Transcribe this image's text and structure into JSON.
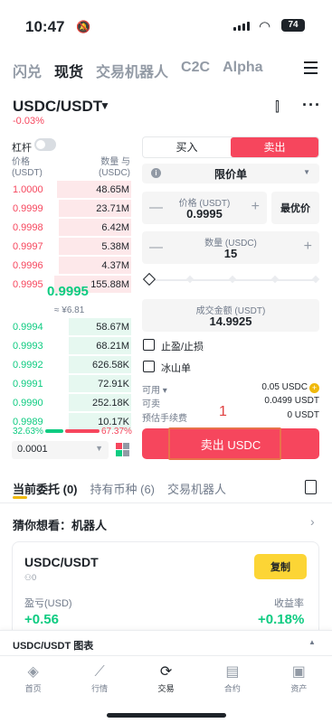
{
  "status_bar": {
    "time": "10:47",
    "battery": "74"
  },
  "top_nav": [
    "闪兑",
    "现货",
    "交易机器人",
    "C2C",
    "Alpha"
  ],
  "pair": {
    "name": "USDC/USDT",
    "change": "-0.03%"
  },
  "order_book": {
    "leverage_label": "杠杆",
    "price_header": "价格",
    "price_unit": "(USDT)",
    "qty_header": "数量 与",
    "qty_unit": "(USDC)",
    "asks": [
      {
        "price": "1.0000",
        "qty": "48.65M",
        "depth": 0.62
      },
      {
        "price": "0.9999",
        "qty": "23.71M",
        "depth": 0.6
      },
      {
        "price": "0.9998",
        "qty": "6.42M",
        "depth": 0.6
      },
      {
        "price": "0.9997",
        "qty": "5.38M",
        "depth": 0.6
      },
      {
        "price": "0.9996",
        "qty": "4.37M",
        "depth": 0.6
      },
      {
        "price": "0.9995",
        "qty": "155.88M",
        "depth": 0.64
      }
    ],
    "mid_price": "0.9995",
    "mid_cny": "≈ ¥6.81",
    "bids": [
      {
        "price": "0.9994",
        "qty": "58.67M",
        "depth": 0.52
      },
      {
        "price": "0.9993",
        "qty": "68.21M",
        "depth": 0.52
      },
      {
        "price": "0.9992",
        "qty": "626.58K",
        "depth": 0.52
      },
      {
        "price": "0.9991",
        "qty": "72.91K",
        "depth": 0.52
      },
      {
        "price": "0.9990",
        "qty": "252.18K",
        "depth": 0.52
      },
      {
        "price": "0.9989",
        "qty": "10.17K",
        "depth": 0.52
      }
    ],
    "buy_ratio": "32.63%",
    "sell_ratio": "67.37%",
    "buy_ratio_value": 0.3263,
    "precision": "0.0001"
  },
  "order_form": {
    "buy_tab": "买入",
    "sell_tab": "卖出",
    "order_type": "限价单",
    "price_label": "价格 (USDT)",
    "price_value": "0.9995",
    "best_price": "最优价",
    "qty_label": "数量 (USDC)",
    "qty_value": "15",
    "total_label": "成交金额 (USDT)",
    "total_value": "14.9925",
    "tp_sl": "止盈/止损",
    "iceberg": "冰山单",
    "available_label": "可用",
    "available_value": "0.05 USDC",
    "sellable_label": "可卖",
    "sellable_value": "0.0499 USDT",
    "fee_label": "预估手续费",
    "fee_value": "0 USDT",
    "annotation": "1",
    "submit": "卖出 USDC"
  },
  "tabs": [
    "当前委托 (0)",
    "持有币种 (6)",
    "交易机器人"
  ],
  "suggestion": {
    "title": "猜你想看：机器人",
    "pair": "USDC/USDT",
    "users": "0",
    "copy": "复制",
    "pnl_label": "盈亏(USD)",
    "pnl_value": "+0.56",
    "roi_label": "收益率",
    "roi_value": "+0.18%"
  },
  "chart_bar": "USDC/USDT 图表",
  "bottom_nav": [
    "首页",
    "行情",
    "交易",
    "合约",
    "资产"
  ],
  "colors": {
    "buy": "#0ecb81",
    "sell": "#f6465d",
    "accent": "#fcd535"
  }
}
